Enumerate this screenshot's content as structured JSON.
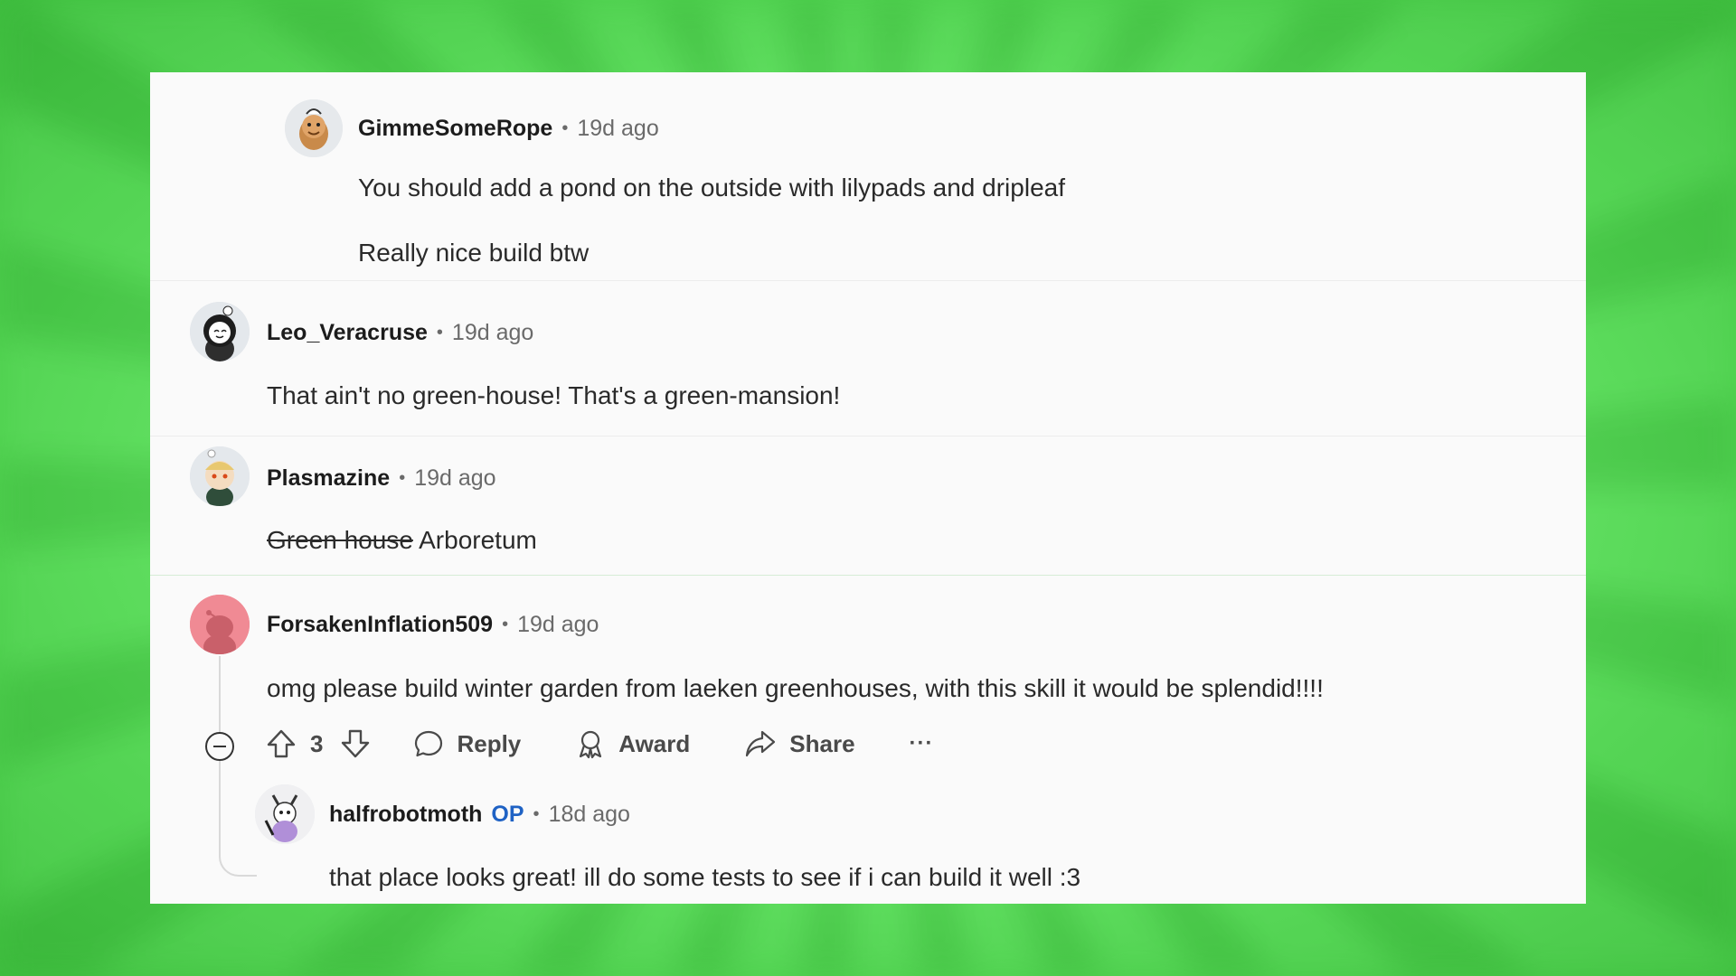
{
  "comments": [
    {
      "username": "GimmeSomeRope",
      "time": "19d ago",
      "lines": [
        "You should add a pond on the outside with lilypads and dripleaf",
        "Really nice build btw"
      ]
    },
    {
      "username": "Leo_Veracruse",
      "time": "19d ago",
      "lines": [
        "That ain't no green-house! That's a green-mansion!"
      ]
    },
    {
      "username": "Plasmazine",
      "time": "19d ago",
      "struck": "Green house",
      "text": "Arboretum"
    },
    {
      "username": "ForsakenInflation509",
      "time": "19d ago",
      "lines": [
        "omg please build winter garden from laeken greenhouses, with this skill it would be splendid!!!!"
      ],
      "votes": "3"
    },
    {
      "username": "halfrobotmoth",
      "op_badge": "OP",
      "time": "18d ago",
      "lines": [
        "that place looks great! ill do some tests to see if i can build it well :3"
      ]
    }
  ],
  "actions": {
    "reply": "Reply",
    "award": "Award",
    "share": "Share",
    "more": "···"
  },
  "separator": "•",
  "colors": {
    "background_green": "#6be86b",
    "op_blue": "#1f62c4",
    "avatar_pink": "#f08a94"
  }
}
